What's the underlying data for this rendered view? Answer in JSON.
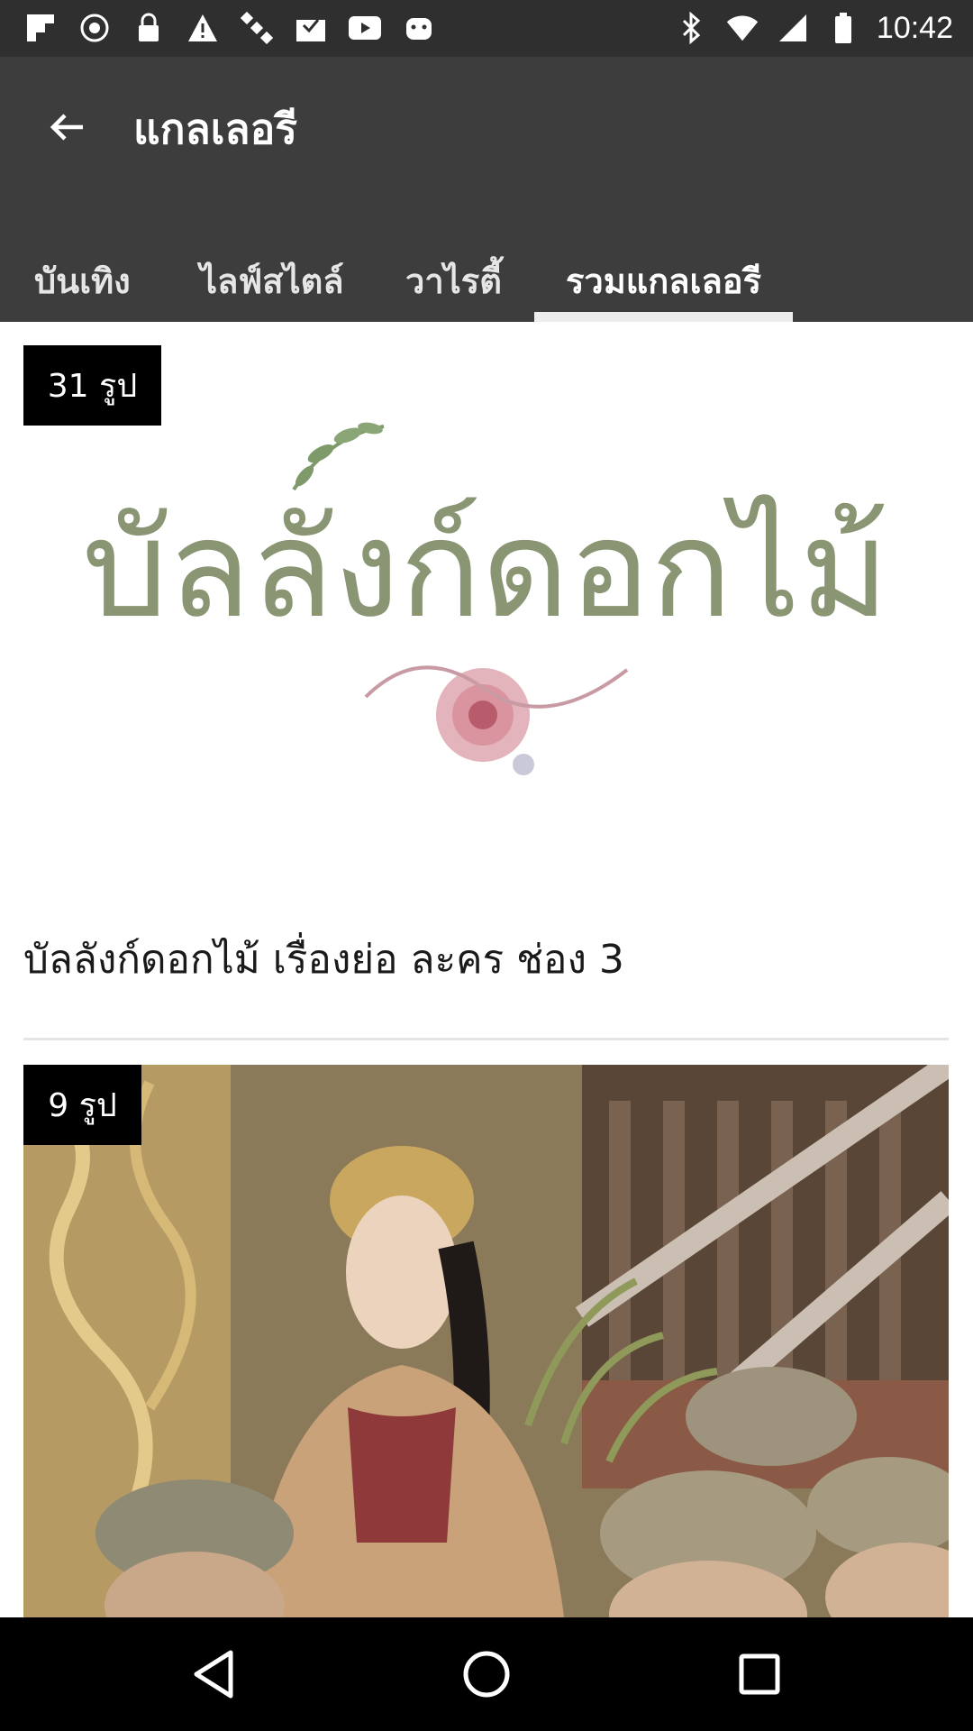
{
  "status_bar": {
    "time": "10:42",
    "left_icons": [
      "flipboard-icon",
      "fake-gps-icon",
      "lock-icon",
      "warning-icon",
      "satellite-icon",
      "mail-check-icon",
      "youtube-icon",
      "android-icon"
    ],
    "right_icons": [
      "bluetooth-icon",
      "wifi-icon",
      "signal-icon",
      "battery-icon"
    ]
  },
  "app_bar": {
    "title": "แกลเลอรี",
    "back_icon": "arrow-back-icon"
  },
  "tabs": [
    {
      "label": "บันเทิง",
      "selected": false
    },
    {
      "label": "ไลฟ์สไตล์",
      "selected": false
    },
    {
      "label": "วาไรตี้",
      "selected": false
    },
    {
      "label": "รวมแกลเลอรี",
      "selected": true
    }
  ],
  "gallery": [
    {
      "badge": "31 รูป",
      "title": "บัลลังก์ดอกไม้ เรื่องย่อ ละคร ช่อง 3",
      "image_text": "บัลลังก์ดอกไม้"
    },
    {
      "badge": "9 รูป",
      "title": ""
    }
  ],
  "nav_bar": {
    "buttons": [
      "back-triangle-icon",
      "home-circle-icon",
      "recents-square-icon"
    ]
  },
  "colors": {
    "status_bar": "#2f2f2f",
    "app_bar": "#3d3d3d",
    "badge": "#000000",
    "indicator": "#eeeeee"
  }
}
